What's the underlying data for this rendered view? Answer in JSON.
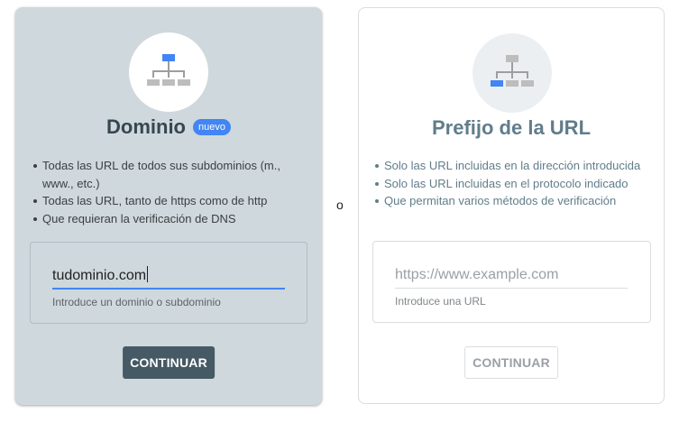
{
  "separator": "o",
  "domain_card": {
    "icon": "sitemap-icon",
    "title": "Dominio",
    "badge": "nuevo",
    "features": [
      "Todas las URL de todos sus subdominios (m., www., etc.)",
      "Todas las URL, tanto de https como de http",
      "Que requieran la verificación de DNS"
    ],
    "input_value": "tudominio.com",
    "helper": "Introduce un dominio o subdominio",
    "button": "CONTINUAR",
    "colors": {
      "background": "#cfd8dc",
      "accent": "#4285f4",
      "button": "#455a64"
    }
  },
  "prefix_card": {
    "icon": "sitemap-branch-icon",
    "title": "Prefijo de la URL",
    "features": [
      "Solo las URL incluidas en la dirección introducida",
      "Solo las URL incluidas en el protocolo indicado",
      "Que permitan varios métodos de verificación"
    ],
    "input_placeholder": "https://www.example.com",
    "helper": "Introduce una URL",
    "button": "CONTINUAR"
  }
}
